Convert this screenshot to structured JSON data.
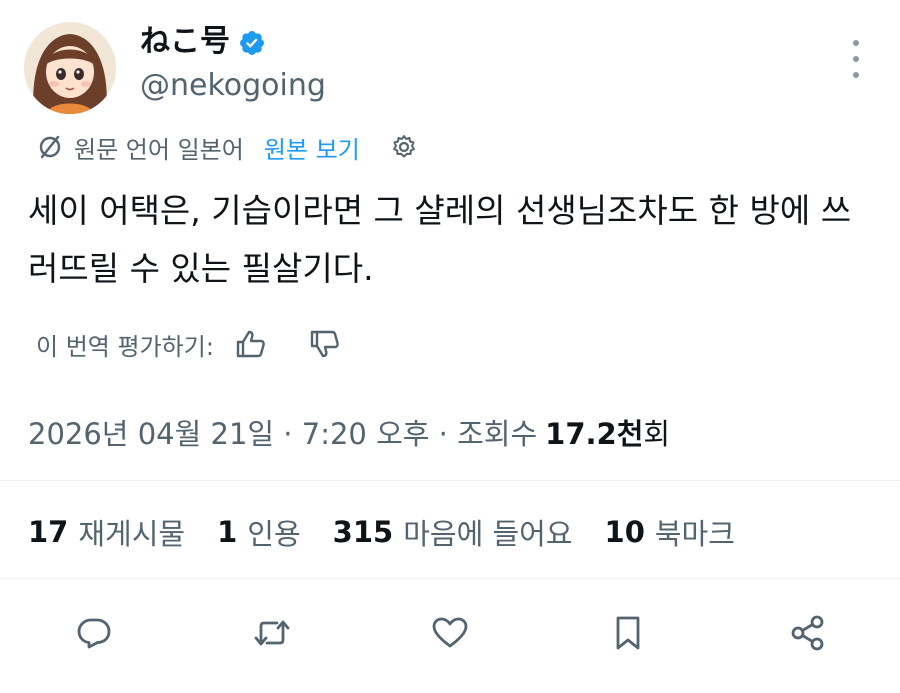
{
  "author": {
    "display_name": "ねこ号",
    "handle": "@nekogoing",
    "verified": true,
    "avatar_icon": "avatar-icon"
  },
  "translation": {
    "info_text": "원문 언어 일본어",
    "show_original_label": "원본 보기",
    "rate_label": "이 번역 평가하기:"
  },
  "tweet": {
    "text": "세이 어택은, 기습이라면 그 샬레의 선생님조차도 한 방에 쓰러뜨릴 수 있는 필살기다."
  },
  "meta": {
    "datetime": "2026년 04월 21일 · 7:20 오후 · 조회수",
    "views_number": "17.2천",
    "views_unit": "회"
  },
  "stats": [
    {
      "count": "17",
      "label": "재게시물"
    },
    {
      "count": "1",
      "label": "인용"
    },
    {
      "count": "315",
      "label": "마음에 들어요"
    },
    {
      "count": "10",
      "label": "북마크"
    }
  ],
  "colors": {
    "accent": "#1d9bf0",
    "text": "#0f1419",
    "secondary": "#536471",
    "divider": "#eff3f4"
  }
}
